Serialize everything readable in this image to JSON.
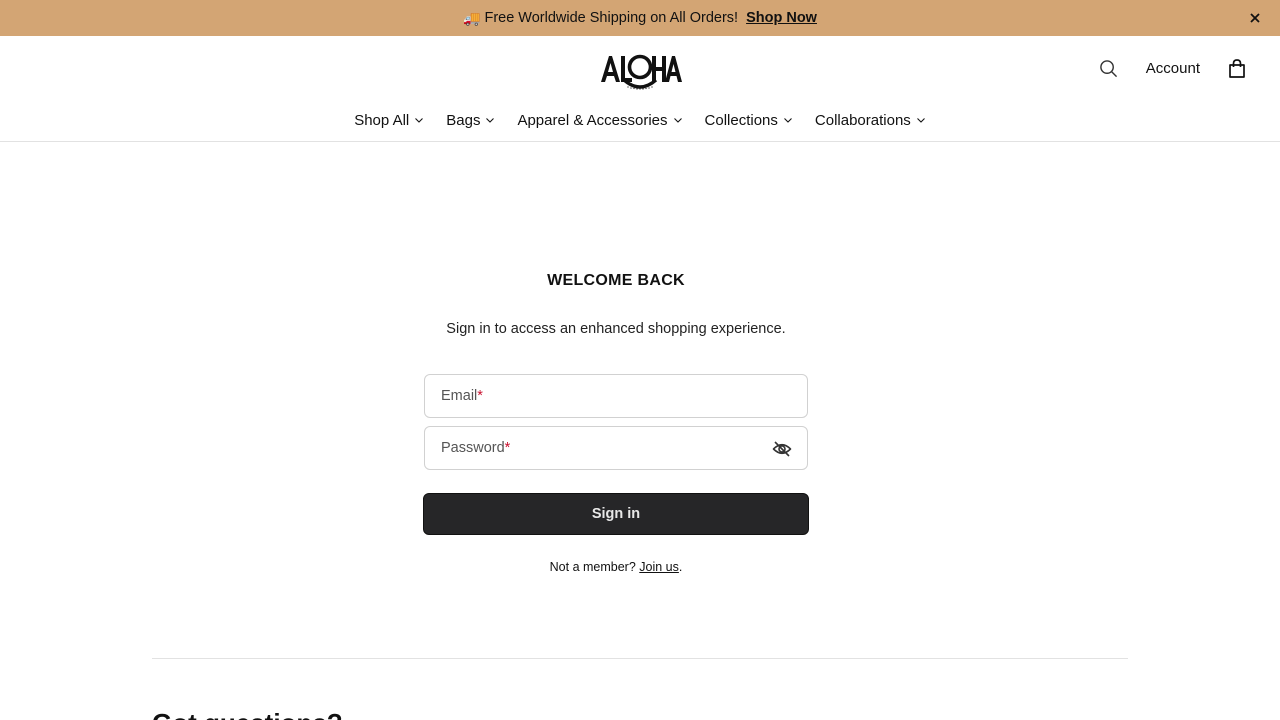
{
  "announcement": {
    "emoji": "🚚",
    "text": "Free Worldwide Shipping on All Orders!",
    "link": "Shop Now",
    "close": "×"
  },
  "header": {
    "logo_alt": "ALOHA",
    "account": "Account",
    "icons": [
      "search-icon",
      "bag-icon"
    ]
  },
  "nav": {
    "items": [
      {
        "label": "Shop All"
      },
      {
        "label": "Bags"
      },
      {
        "label": "Apparel & Accessories"
      },
      {
        "label": "Collections"
      },
      {
        "label": "Collaborations"
      }
    ]
  },
  "login": {
    "title": "WELCOME BACK",
    "subtitle": "Sign in to access an enhanced shopping experience.",
    "email_label": "Email",
    "password_label": "Password",
    "required_mark": "*",
    "submit": "Sign in",
    "member_prompt": "Not a member? ",
    "join_link": "Join us",
    "period": "."
  },
  "footer": {
    "questions": "Got questions?"
  },
  "colors": {
    "announce_bg": "#d3a574",
    "button_bg": "#262628",
    "required": "#c8102e"
  }
}
